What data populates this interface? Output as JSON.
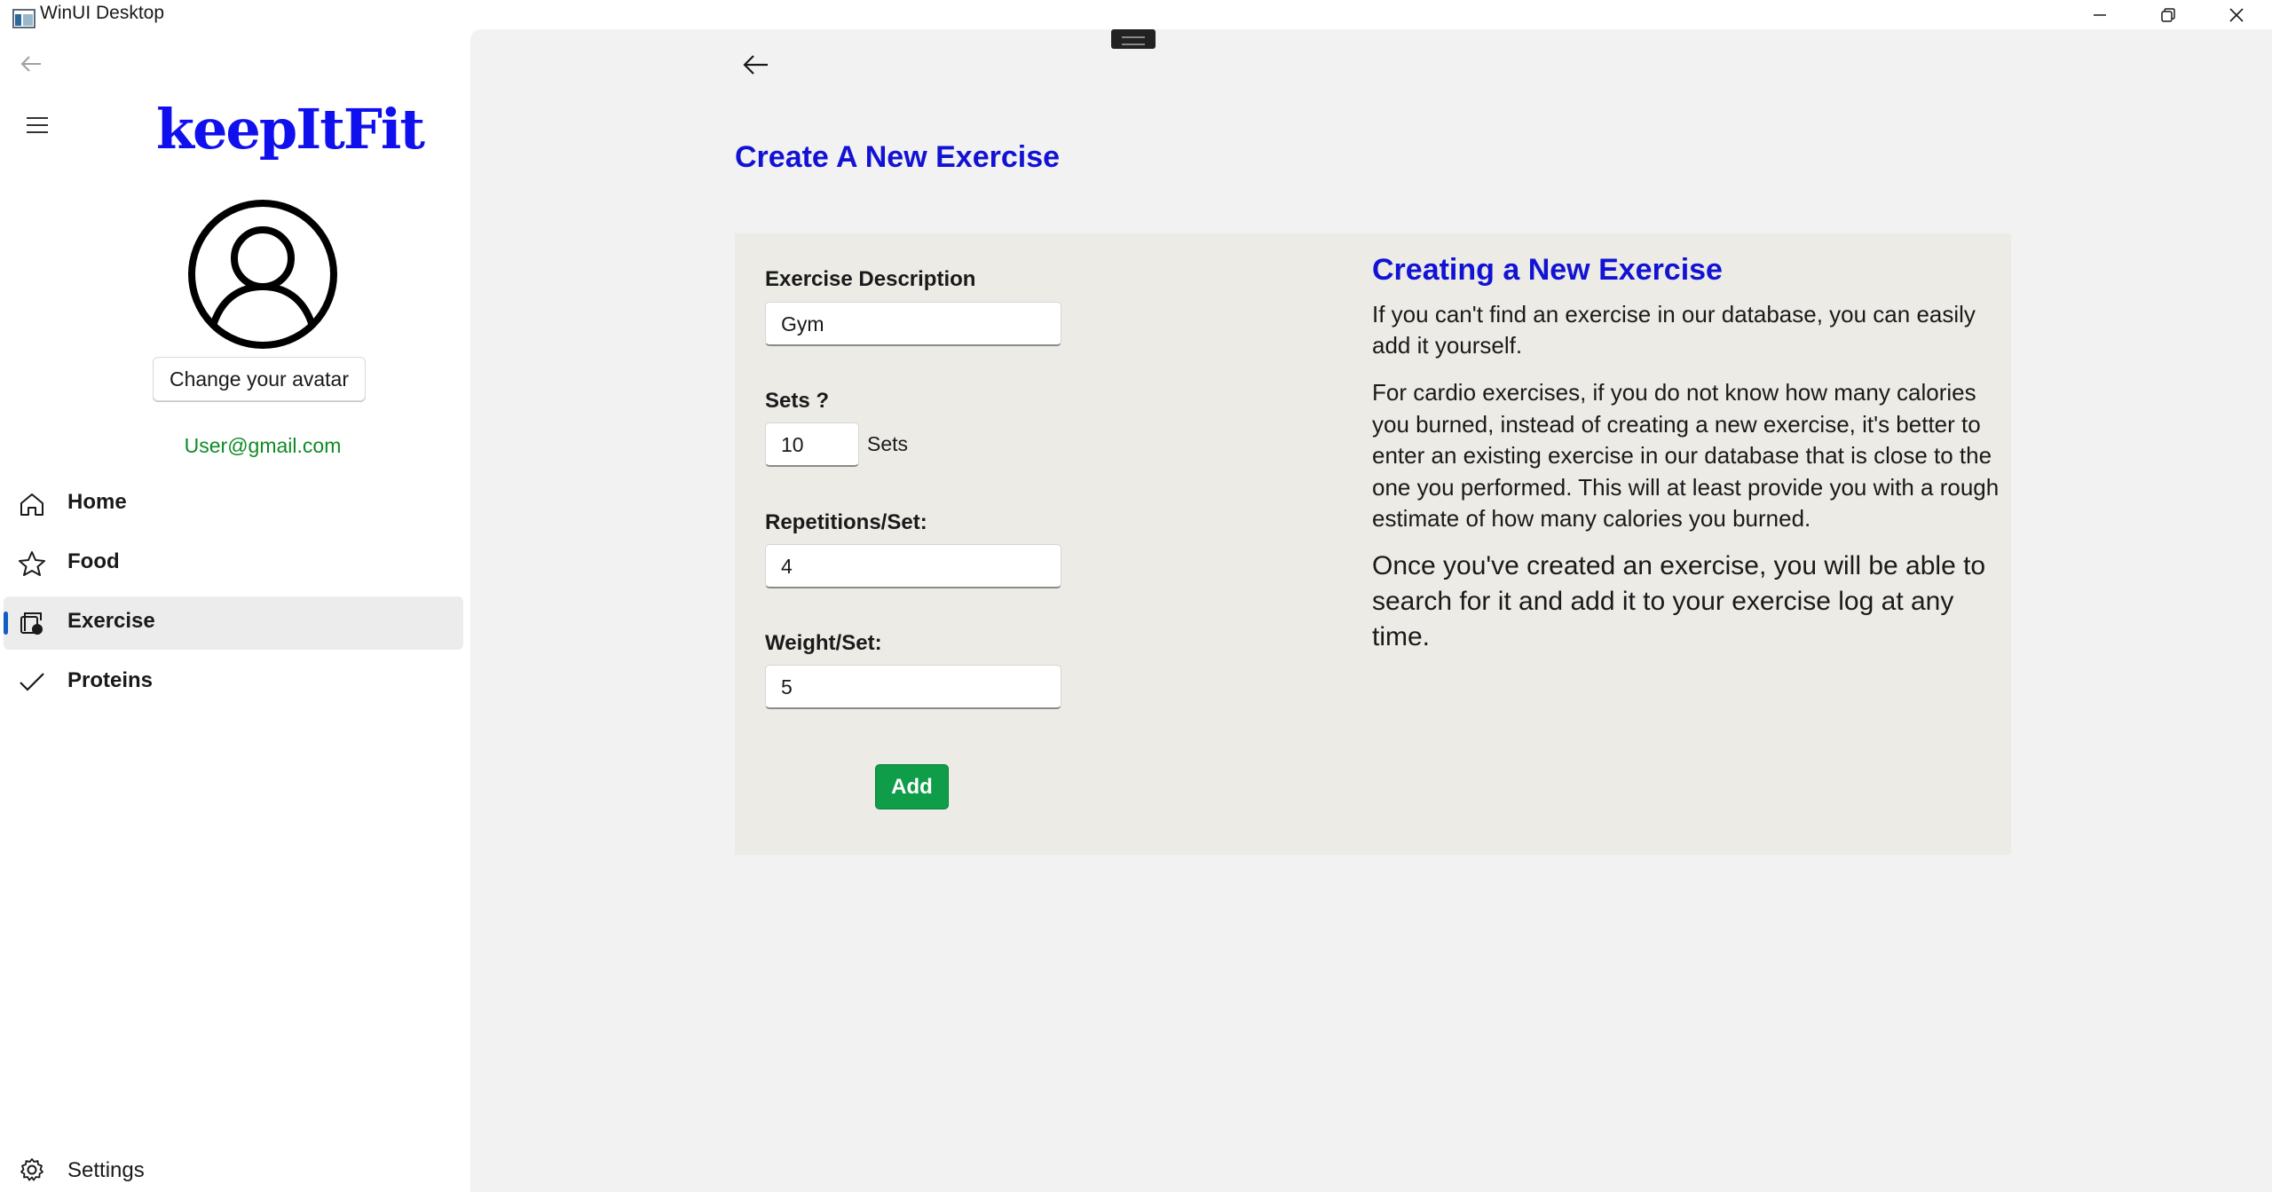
{
  "window": {
    "title": "WinUI Desktop"
  },
  "sidebar": {
    "logo": "keepItFit",
    "avatar_button": "Change your avatar",
    "email": "User@gmail.com",
    "nav": [
      {
        "label": "Home",
        "icon": "home-icon",
        "selected": false
      },
      {
        "label": "Food",
        "icon": "star-icon",
        "selected": false
      },
      {
        "label": "Exercise",
        "icon": "exercise-icon",
        "selected": true
      },
      {
        "label": "Proteins",
        "icon": "checkmark-icon",
        "selected": false
      }
    ],
    "settings": "Settings"
  },
  "main": {
    "title": "Create A New Exercise",
    "form": {
      "description_label": "Exercise Description",
      "description_value": "Gym",
      "sets_label": "Sets ?",
      "sets_value": "10",
      "sets_unit": "Sets",
      "reps_label": "Repetitions/Set:",
      "reps_value": "4",
      "weight_label": "Weight/Set:",
      "weight_value": "5",
      "add_button": "Add"
    },
    "help": {
      "title": "Creating a New Exercise",
      "p1": "If you can't find an exercise in our database, you can easily add it yourself.",
      "p2": "For cardio exercises, if you do not know how many calories you burned, instead of creating a new exercise, it's better to enter an existing exercise in our database that is close to the one you performed. This will at least provide you with a rough estimate of how many calories you burned.",
      "p3": "Once you've created an exercise, you will be able to search for it and add it to your exercise log at any time."
    }
  },
  "colors": {
    "brand_blue": "#1212d4",
    "email_green": "#0f8a25",
    "add_green": "#0f9d4a",
    "selected_indicator": "#0f5fc4"
  }
}
